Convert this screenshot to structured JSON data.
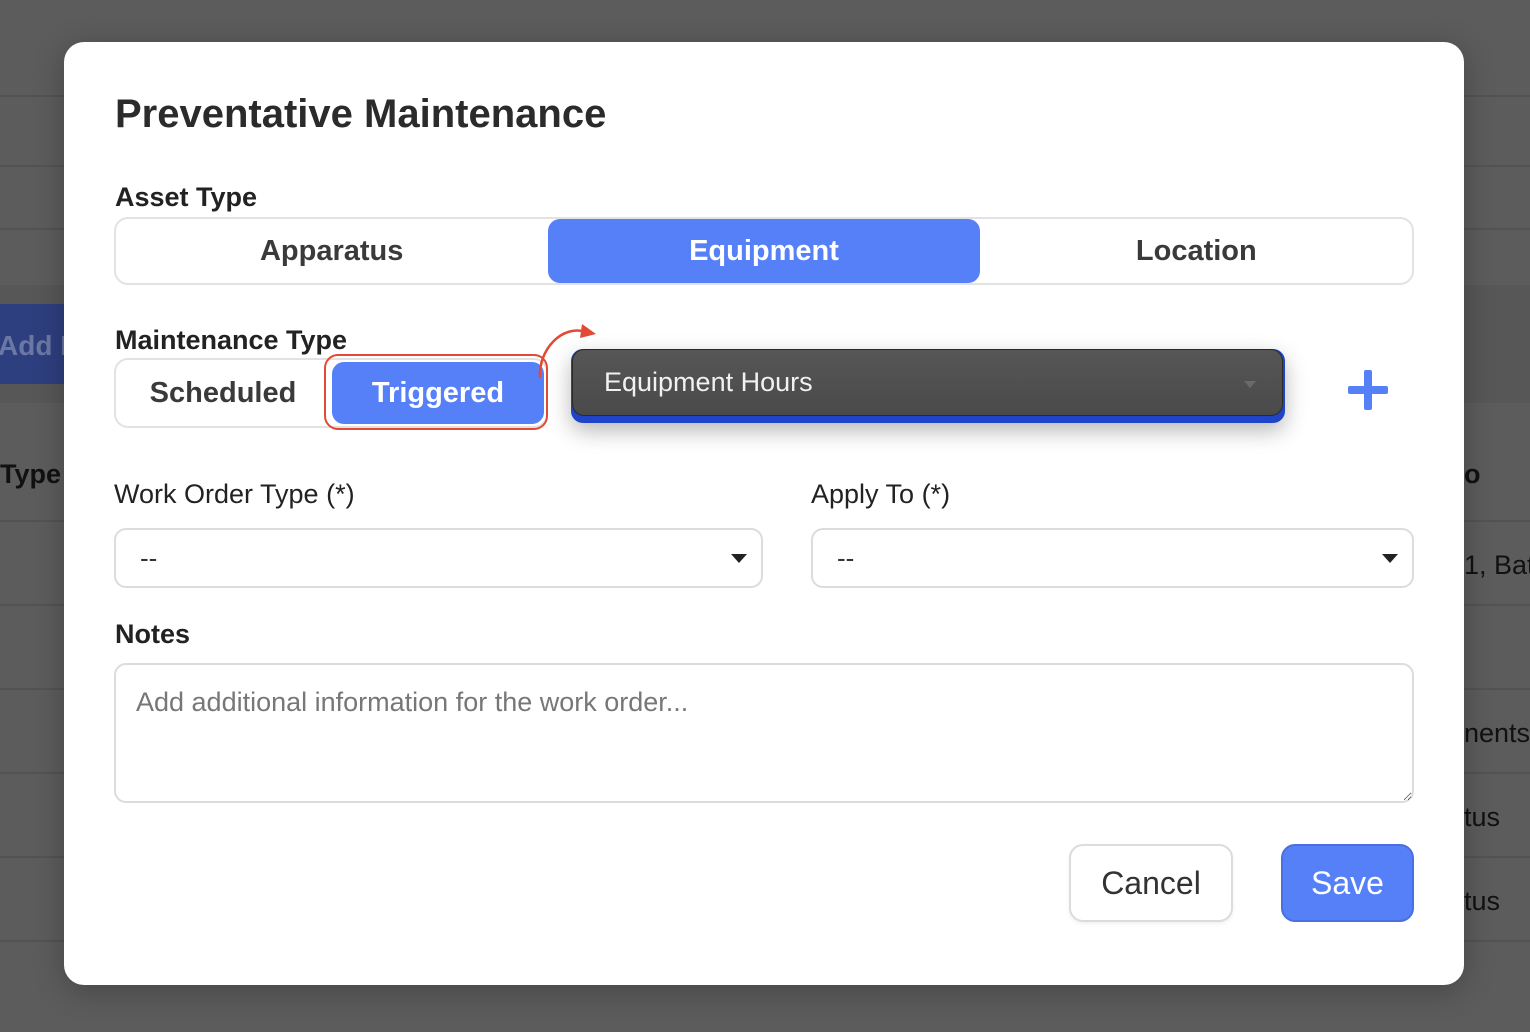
{
  "background": {
    "add_button_label": "Add M",
    "table_header_left": "Type",
    "table_header_right": "o",
    "row_snippets": [
      "1, Bat",
      "nents",
      "tus",
      "tus"
    ]
  },
  "modal": {
    "title": "Preventative Maintenance",
    "asset_type": {
      "label": "Asset Type",
      "options": [
        "Apparatus",
        "Equipment",
        "Location"
      ],
      "selected": "Equipment"
    },
    "maintenance_type": {
      "label": "Maintenance Type",
      "options": [
        "Scheduled",
        "Triggered"
      ],
      "selected": "Triggered"
    },
    "trigger_select": {
      "value": "Equipment Hours"
    },
    "work_order_type": {
      "label": "Work Order Type (*)",
      "value": "--"
    },
    "apply_to": {
      "label": "Apply To (*)",
      "value": "--"
    },
    "notes": {
      "label": "Notes",
      "placeholder": "Add additional information for the work order..."
    },
    "buttons": {
      "cancel": "Cancel",
      "save": "Save"
    }
  },
  "colors": {
    "accent": "#5580f7",
    "overlay": "#5c5c5c",
    "annotation": "#e24a35",
    "dropdown_bg": "#4f4f4f"
  },
  "icons": {
    "add": "plus-icon",
    "dropdown": "chevron-down-icon"
  }
}
